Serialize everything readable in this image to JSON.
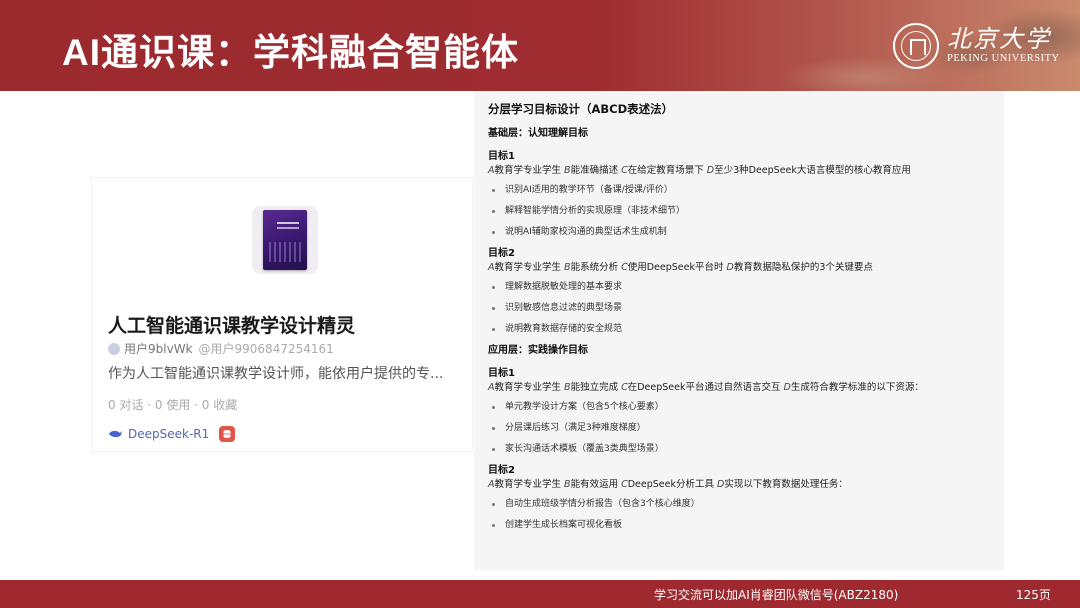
{
  "header": {
    "title": "AI通识课：学科融合智能体",
    "logo_cn": "北京大学",
    "logo_en": "PEKING UNIVERSITY"
  },
  "card": {
    "title": "人工智能通识课教学设计精灵",
    "user_name": "用户9blvWk",
    "user_handle": "@用户9906847254161",
    "description": "作为人工智能通识课教学设计师，能依用户提供的专...",
    "stats": "0 对话 · 0 使用 · 0 收藏",
    "model": "DeepSeek-R1",
    "icons": [
      "book-cover",
      "user-icon",
      "whale-icon",
      "database-icon"
    ]
  },
  "panel": {
    "heading": "分层学习目标设计（ABCD表述法）",
    "layer1": "基础层：认知理解目标",
    "l1_goal1": {
      "title": "目标1",
      "desc_a": "A",
      "desc_a_text": "教育学专业学生 ",
      "desc_b": "B",
      "desc_b_text": "能准确描述 ",
      "desc_c": "C",
      "desc_c_text": "在给定教育场景下 ",
      "desc_d": "D",
      "desc_d_text": "至少3种DeepSeek大语言模型的核心教育应用",
      "items": [
        "识别AI适用的教学环节（备课/授课/评价）",
        "解释智能学情分析的实现原理（非技术细节）",
        "说明AI辅助家校沟通的典型话术生成机制"
      ]
    },
    "l1_goal2": {
      "title": "目标2",
      "desc_a": "A",
      "desc_a_text": "教育学专业学生 ",
      "desc_b": "B",
      "desc_b_text": "能系统分析 ",
      "desc_c": "C",
      "desc_c_text": "使用DeepSeek平台时 ",
      "desc_d": "D",
      "desc_d_text": "教育数据隐私保护的3个关键要点",
      "items": [
        "理解数据脱敏处理的基本要求",
        "识别敏感信息过滤的典型场景",
        "说明教育数据存储的安全规范"
      ]
    },
    "layer2": "应用层：实践操作目标",
    "l2_goal1": {
      "title": "目标1",
      "desc_a": "A",
      "desc_a_text": "教育学专业学生 ",
      "desc_b": "B",
      "desc_b_text": "能独立完成 ",
      "desc_c": "C",
      "desc_c_text": "在DeepSeek平台通过自然语言交互 ",
      "desc_d": "D",
      "desc_d_text": "生成符合教学标准的以下资源：",
      "items": [
        "单元教学设计方案（包含5个核心要素）",
        "分层课后练习（满足3种难度梯度）",
        "家长沟通话术模板（覆盖3类典型场景）"
      ]
    },
    "l2_goal2": {
      "title": "目标2",
      "desc_a": "A",
      "desc_a_text": "教育学专业学生 ",
      "desc_b": "B",
      "desc_b_text": "能有效运用 ",
      "desc_c": "C",
      "desc_c_text": "DeepSeek分析工具 ",
      "desc_d": "D",
      "desc_d_text": "实现以下教育数据处理任务：",
      "items": [
        "自动生成班级学情分析报告（包含3个核心维度）",
        "创建学生成长档案可视化看板"
      ]
    }
  },
  "footer": {
    "note": "学习交流可以加AI肖睿团队微信号(ABZ2180)",
    "page": "125页"
  },
  "colors": {
    "brand_red": "#9e2a2f",
    "panel_bg": "#f5f5f6",
    "db_red": "#e2564a",
    "model_blue": "#5566aa"
  }
}
